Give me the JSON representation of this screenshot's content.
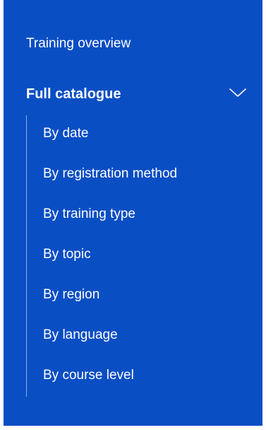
{
  "nav": {
    "top_link": "Training overview",
    "section": {
      "title": "Full catalogue",
      "expanded": true,
      "icon": "chevron-down-icon",
      "items": [
        "By date",
        "By registration method",
        "By training type",
        "By topic",
        "By region",
        "By language",
        "By course level"
      ]
    }
  },
  "colors": {
    "panel_background": "#0a4ec4",
    "text": "#ffffff"
  }
}
